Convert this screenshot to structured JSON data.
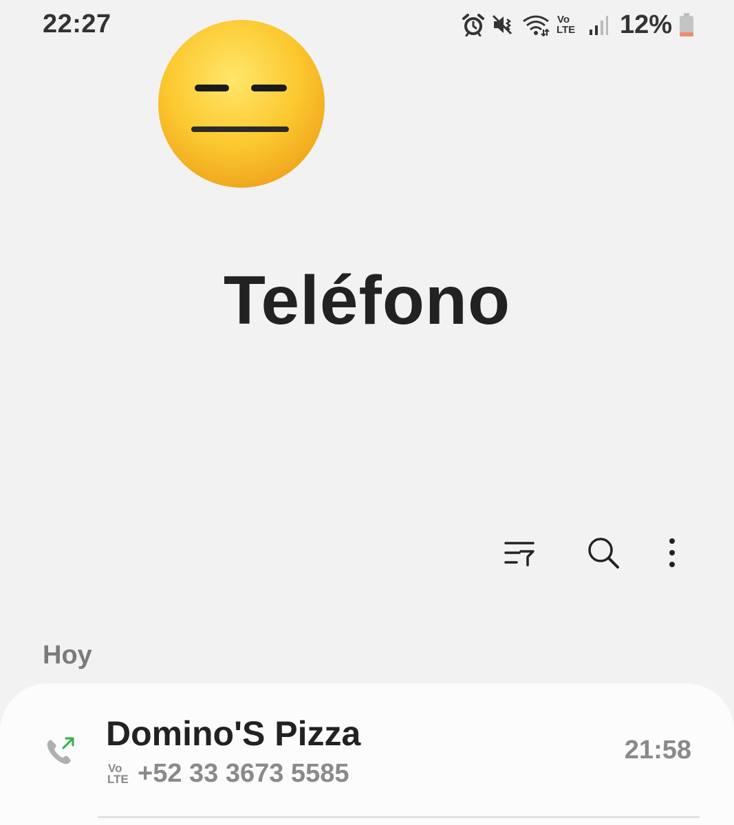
{
  "status_bar": {
    "time": "22:27",
    "battery_percent": "12%",
    "icons": [
      "alarm-icon",
      "mute-vibrate-icon",
      "wifi-icon",
      "volte-icon",
      "signal-icon",
      "battery-icon"
    ],
    "volte_top": "Vo",
    "volte_bottom": "LTE"
  },
  "overlay": {
    "emoji": "expressionless-face-emoji"
  },
  "header": {
    "title": "Teléfono"
  },
  "toolbar": {
    "icons": [
      "filter-icon",
      "search-icon",
      "more-options-icon"
    ]
  },
  "call_log": {
    "section_label": "Hoy",
    "entries": [
      {
        "name": "Domino'S Pizza",
        "number": "+52 33 3673 5585",
        "time": "21:58",
        "call_type": "outgoing-call-icon",
        "badge_top": "Vo",
        "badge_bottom": "LTE"
      }
    ]
  },
  "colors": {
    "background": "#f2f2f2",
    "card": "#fcfcfc",
    "outgoing_arrow": "#2bb34a",
    "battery_low": "#f08a6e"
  }
}
